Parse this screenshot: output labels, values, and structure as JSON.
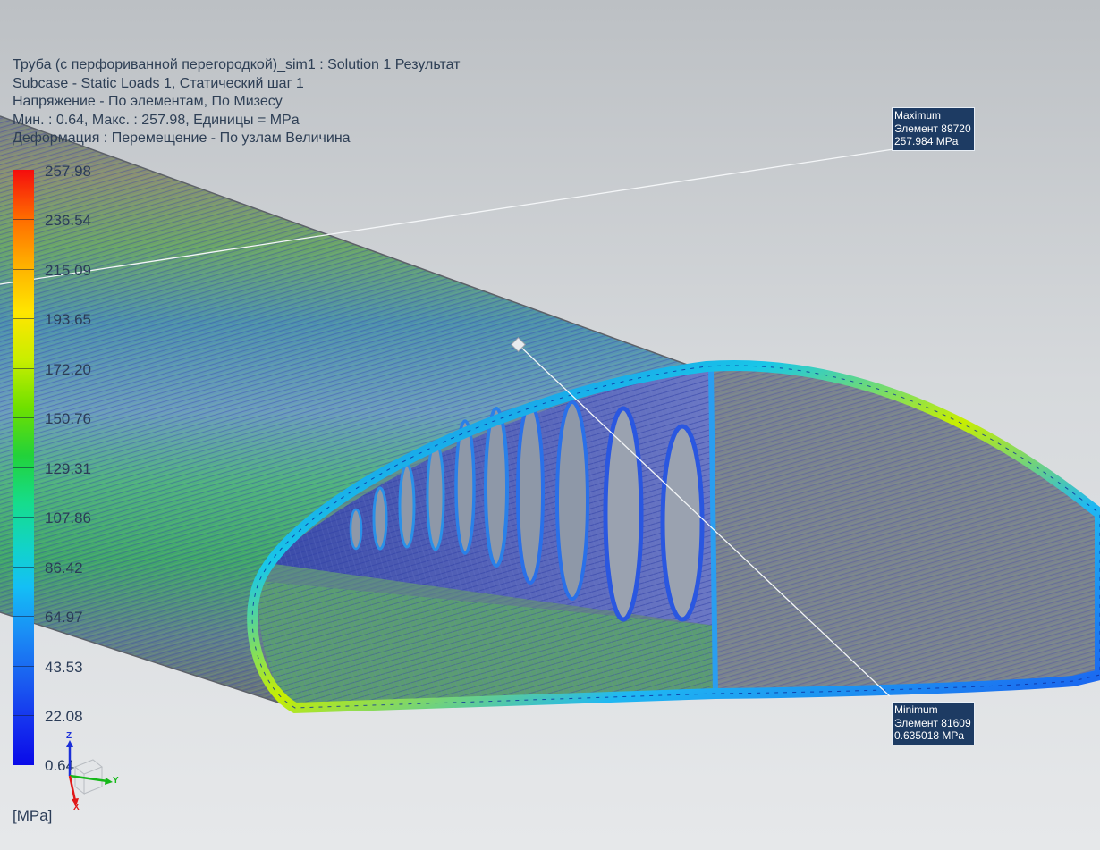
{
  "info": {
    "title": "Труба (с перфориванной перегородкой)_sim1 : Solution 1 Результат",
    "subcase": "Subcase - Static Loads 1, Статический шаг 1",
    "stress": "Напряжение - По элементам, По Мизесу",
    "range": "Мин. : 0.64, Макс. : 257.98, Единицы = MPa",
    "deformation": "Деформация : Перемещение - По узлам Величина"
  },
  "legend": {
    "labels": [
      "257.98",
      "236.54",
      "215.09",
      "193.65",
      "172.20",
      "150.76",
      "129.31",
      "107.86",
      "86.42",
      "64.97",
      "43.53",
      "22.08",
      "0.64"
    ],
    "units": "[MPa]"
  },
  "markers": {
    "maximum": {
      "title": "Maximum",
      "element": "Элемент 89720",
      "value": "257.984 MPa"
    },
    "minimum": {
      "title": "Minimum",
      "element": "Элемент 81609",
      "value": "0.635018 MPa"
    }
  },
  "triad": {
    "x": "Y",
    "y": "X",
    "z": "Z"
  },
  "colors": {
    "text": "#2e3f55",
    "callout_bg": "#1d3b63",
    "mesh_dark": "#3b4a9a",
    "mesh_green": "#3fbf3a",
    "mesh_cyan": "#22c4dd"
  }
}
